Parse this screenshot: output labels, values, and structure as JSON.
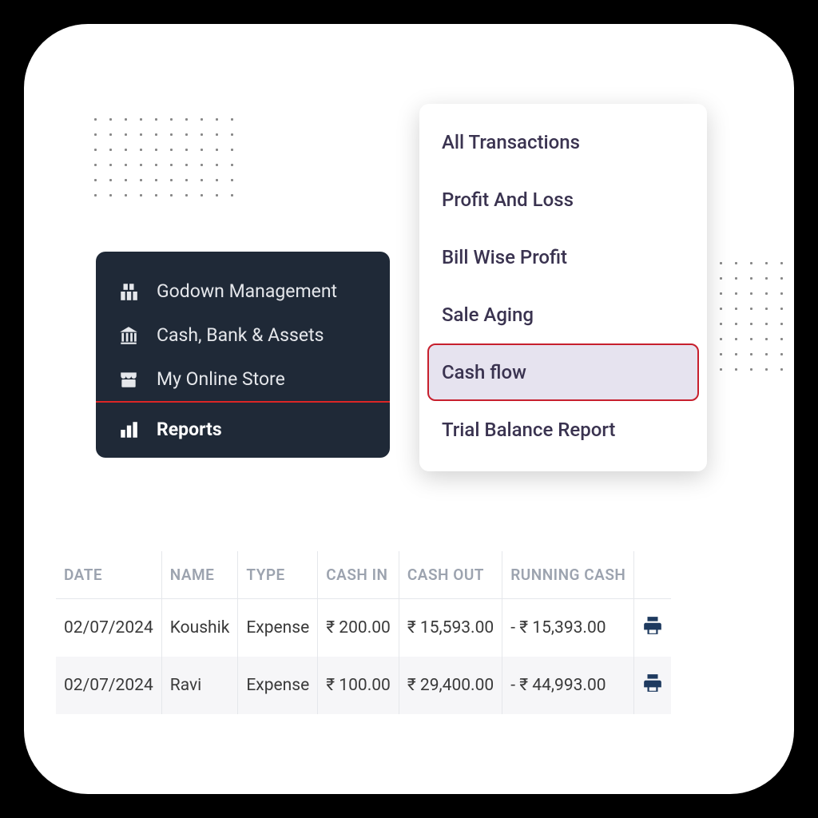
{
  "sidebar": {
    "items": [
      {
        "label": "Godown Management",
        "icon": "building"
      },
      {
        "label": "Cash, Bank & Assets",
        "icon": "bank"
      },
      {
        "label": "My Online Store",
        "icon": "store"
      },
      {
        "label": "Reports",
        "icon": "bars",
        "active": true
      }
    ]
  },
  "menu": {
    "items": [
      {
        "label": "All Transactions"
      },
      {
        "label": "Profit And Loss"
      },
      {
        "label": "Bill Wise Profit"
      },
      {
        "label": "Sale Aging"
      },
      {
        "label": "Cash flow",
        "selected": true
      },
      {
        "label": "Trial Balance Report"
      }
    ]
  },
  "table": {
    "headers": {
      "date": "DATE",
      "name": "NAME",
      "type": "TYPE",
      "cash_in": "CASH IN",
      "cash_out": "CASH OUT",
      "running": "RUNNING CASH"
    },
    "rows": [
      {
        "date": "02/07/2024",
        "name": "Koushik",
        "type": "Expense",
        "cash_in": "₹ 200.00",
        "cash_out": "₹ 15,593.00",
        "running": "- ₹ 15,393.00"
      },
      {
        "date": "02/07/2024",
        "name": "Ravi",
        "type": "Expense",
        "cash_in": "₹ 100.00",
        "cash_out": "₹ 29,400.00",
        "running": "- ₹ 44,993.00"
      }
    ]
  }
}
